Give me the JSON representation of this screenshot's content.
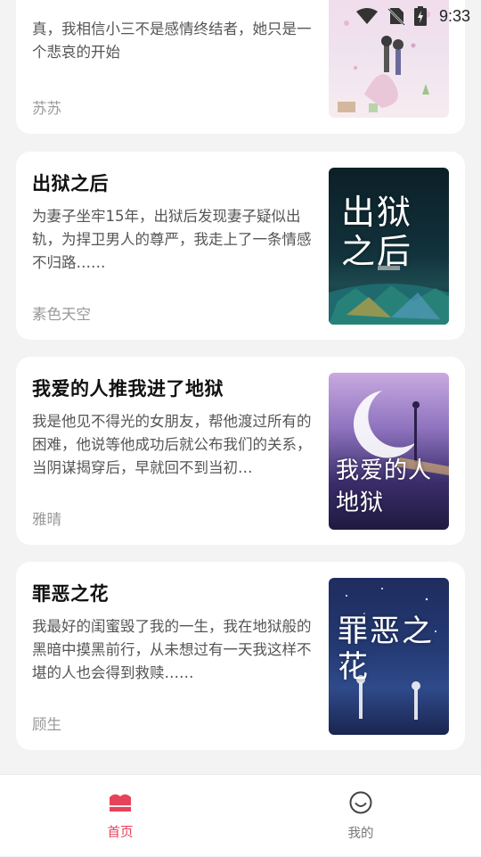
{
  "status_bar": {
    "time": "9:33"
  },
  "books": [
    {
      "title": "",
      "description": "真，我相信小三不是感情终结者，她只是一个悲哀的开始",
      "author": "苏苏",
      "cover_title": ""
    },
    {
      "title": "出狱之后",
      "description": "为妻子坐牢15年，出狱后发现妻子疑似出轨，为捍卫男人的尊严，我走上了一条情感不归路……",
      "author": "素色天空",
      "cover_title": "出狱之后"
    },
    {
      "title": "我爱的人推我进了地狱",
      "description": "我是他见不得光的女朋友，帮他渡过所有的困难，他说等他成功后就公布我们的关系，当阴谋揭穿后，早就回不到当初…",
      "author": "雅晴",
      "cover_title": "我爱的人 地狱"
    },
    {
      "title": "罪恶之花",
      "description": "我最好的闺蜜毁了我的一生，我在地狱般的黑暗中摸黑前行，从未想过有一天我这样不堪的人也会得到救赎……",
      "author": "顾生",
      "cover_title": "罪恶之花"
    }
  ],
  "tabs": [
    {
      "label": "首页",
      "active": true,
      "icon": "book-icon",
      "color": "#e8415a"
    },
    {
      "label": "我的",
      "active": false,
      "icon": "smiley-icon",
      "color": "#777777"
    }
  ]
}
